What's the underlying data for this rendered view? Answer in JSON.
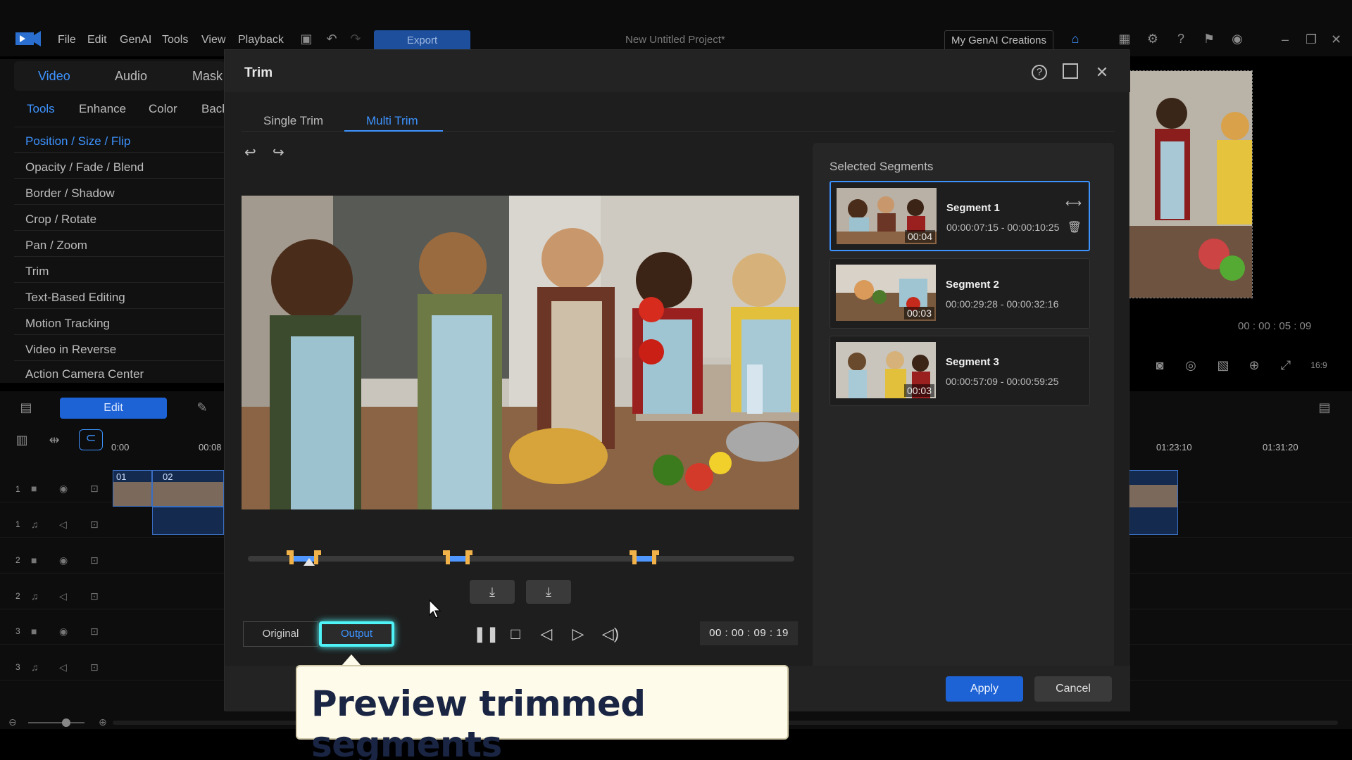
{
  "app": {
    "menu": [
      "File",
      "Edit",
      "GenAI",
      "Tools",
      "View",
      "Playback"
    ],
    "export_label": "Export",
    "project_title": "New Untitled Project*",
    "genai_label": "My GenAI Creations"
  },
  "left_panel": {
    "mode_tabs": [
      "Video",
      "Audio",
      "Mask"
    ],
    "sub_tabs": [
      "Tools",
      "Enhance",
      "Color",
      "Back"
    ],
    "tools": [
      "Position / Size / Flip",
      "Opacity / Fade / Blend",
      "Border / Shadow",
      "Crop / Rotate",
      "Pan / Zoom",
      "Trim",
      "Text-Based Editing",
      "Motion Tracking",
      "Video in Reverse",
      "Action Camera Center"
    ],
    "edit_label": "Edit"
  },
  "timeline": {
    "ruler": [
      "0:00",
      "00:08"
    ],
    "right_ruler": [
      "01:23:10",
      "01:31:20"
    ],
    "clips": [
      "01",
      "02"
    ],
    "track_numbers": [
      "1",
      "1",
      "2",
      "2",
      "3",
      "3"
    ]
  },
  "right_preview": {
    "time": "00 : 00 : 05 : 09",
    "aspect": "16:9"
  },
  "dialog": {
    "title": "Trim",
    "tabs": [
      "Single Trim",
      "Multi Trim"
    ],
    "active_tab": "Multi Trim",
    "original_label": "Original",
    "output_label": "Output",
    "timecode": "00 : 00 : 09 : 19",
    "segments_title": "Selected Segments",
    "segments": [
      {
        "name": "Segment 1",
        "range": "00:00:07:15 - 00:00:10:25",
        "duration": "00:04",
        "selected": true
      },
      {
        "name": "Segment 2",
        "range": "00:00:29:28 - 00:00:32:16",
        "duration": "00:03",
        "selected": false
      },
      {
        "name": "Segment 3",
        "range": "00:00:57:09 - 00:00:59:25",
        "duration": "00:03",
        "selected": false
      }
    ],
    "apply_label": "Apply",
    "cancel_label": "Cancel"
  },
  "caption": {
    "text": "Preview trimmed segments"
  },
  "colors": {
    "accent": "#3d93ff",
    "highlight": "#4ff2f7",
    "marker": "#f1b24a"
  }
}
